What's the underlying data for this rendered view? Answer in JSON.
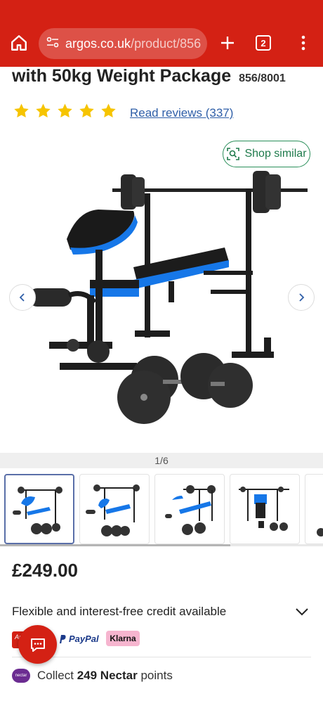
{
  "browser": {
    "url_domain": "argos.co.uk",
    "url_path": "/product/856",
    "tab_count": "2"
  },
  "product": {
    "title": "with 50kg Weight Package",
    "sku": "856/8001",
    "rating_stars": 5,
    "reviews_link": "Read reviews (337)",
    "shop_similar": "Shop similar",
    "image_counter": "1/6",
    "price": "£249.00"
  },
  "credit": {
    "text": "Flexible and interest-free credit available",
    "argos_card_label": "Argos",
    "paypal_label": "PayPal",
    "klarna_label": "Klarna"
  },
  "nectar": {
    "logo_text": "nectar",
    "prefix": "Collect",
    "points": "249 Nectar",
    "suffix": "points"
  },
  "colors": {
    "brand_red": "#d42114",
    "link_blue": "#2f5fa8",
    "star_yellow": "#f6c400",
    "shop_similar_green": "#1e7a4b"
  }
}
